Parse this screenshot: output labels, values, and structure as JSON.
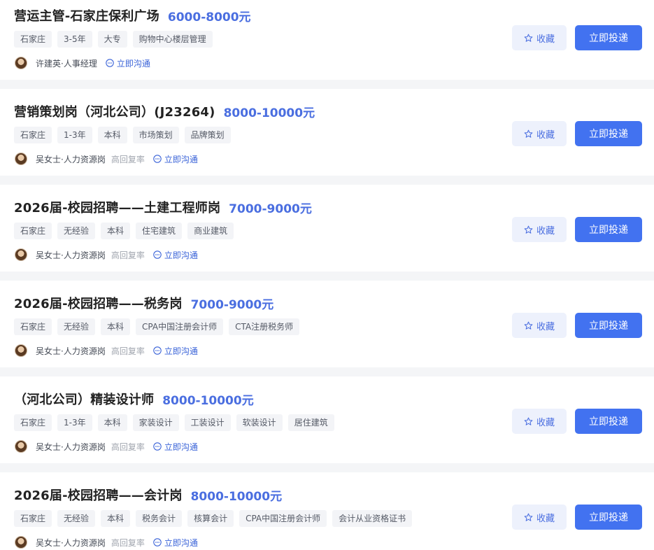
{
  "colors": {
    "salary": "#4a6ee0",
    "primary_button": "#4272f0",
    "favorite_button_bg": "#edf1fc",
    "chat_link": "#3a63d8"
  },
  "actions": {
    "favorite_label": "收藏",
    "apply_label": "立即投递",
    "chat_label": "立即沟通",
    "favorite_icon": "star-icon",
    "chat_icon": "chat-bubble-icon"
  },
  "jobs": [
    {
      "title": "营运主管-石家庄保利广场",
      "salary": "6000-8000元",
      "tags": [
        "石家庄",
        "3-5年",
        "大专",
        "购物中心楼层管理"
      ],
      "recruiter": "许建英·人事经理",
      "reply_badge": ""
    },
    {
      "title": "营销策划岗（河北公司）(J23264)",
      "salary": "8000-10000元",
      "tags": [
        "石家庄",
        "1-3年",
        "本科",
        "市场策划",
        "品牌策划"
      ],
      "recruiter": "吴女士·人力资源岗",
      "reply_badge": "高回复率"
    },
    {
      "title": "2026届-校园招聘——土建工程师岗",
      "salary": "7000-9000元",
      "tags": [
        "石家庄",
        "无经验",
        "本科",
        "住宅建筑",
        "商业建筑"
      ],
      "recruiter": "吴女士·人力资源岗",
      "reply_badge": "高回复率"
    },
    {
      "title": "2026届-校园招聘——税务岗",
      "salary": "7000-9000元",
      "tags": [
        "石家庄",
        "无经验",
        "本科",
        "CPA中国注册会计师",
        "CTA注册税务师"
      ],
      "recruiter": "吴女士·人力资源岗",
      "reply_badge": "高回复率"
    },
    {
      "title": "（河北公司）精装设计师",
      "salary": "8000-10000元",
      "tags": [
        "石家庄",
        "1-3年",
        "本科",
        "家装设计",
        "工装设计",
        "软装设计",
        "居住建筑"
      ],
      "recruiter": "吴女士·人力资源岗",
      "reply_badge": "高回复率"
    },
    {
      "title": "2026届-校园招聘——会计岗",
      "salary": "8000-10000元",
      "tags": [
        "石家庄",
        "无经验",
        "本科",
        "税务会计",
        "核算会计",
        "CPA中国注册会计师",
        "会计从业资格证书"
      ],
      "recruiter": "吴女士·人力资源岗",
      "reply_badge": "高回复率"
    }
  ]
}
